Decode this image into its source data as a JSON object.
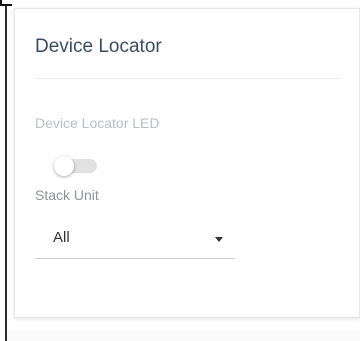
{
  "panel": {
    "title": "Device Locator"
  },
  "device_locator_led": {
    "label": "Device Locator LED",
    "enabled": false
  },
  "stack_unit": {
    "label": "Stack Unit",
    "selected": "All"
  }
}
